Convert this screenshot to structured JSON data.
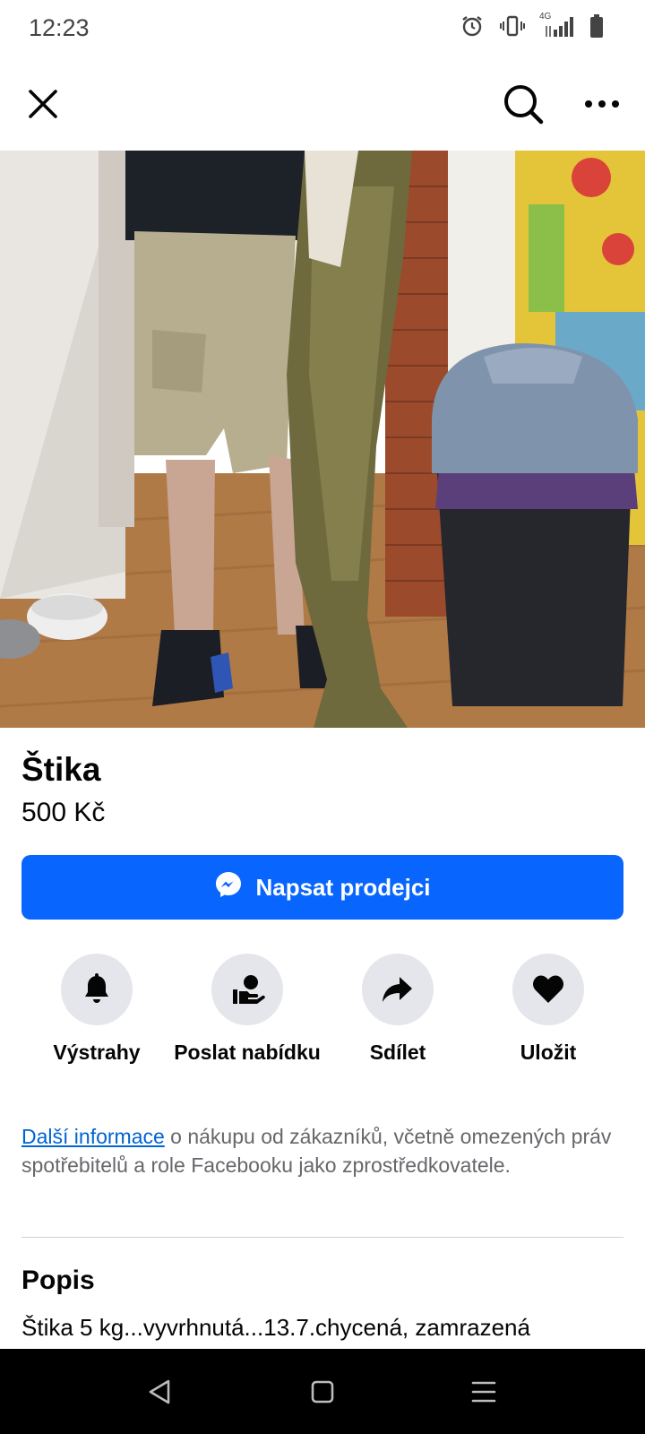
{
  "status_bar": {
    "time": "12:23",
    "network": "4G",
    "icons": [
      "alarm-icon",
      "vibrate-icon",
      "signal-icon",
      "battery-icon"
    ]
  },
  "top_bar": {
    "icons": [
      "close-icon",
      "search-icon",
      "more-icon"
    ]
  },
  "listing": {
    "title": "Štika",
    "price": "500 Kč",
    "message_button": "Napsat prodejci"
  },
  "actions": [
    {
      "label": "Výstrahy",
      "icon": "bell-icon"
    },
    {
      "label": "Poslat nabídku",
      "icon": "offer-icon"
    },
    {
      "label": "Sdílet",
      "icon": "share-icon"
    },
    {
      "label": "Uložit",
      "icon": "heart-icon"
    }
  ],
  "info": {
    "link": "Další informace",
    "text": " o nákupu od zákazníků, včetně omezených práv spotřebitelů a role Facebooku jako zprostředkovatele."
  },
  "description": {
    "heading": "Popis",
    "text": "Štika 5 kg...vyvrhnutá...13.7.chycená, zamrazená"
  },
  "nav_bar": {
    "icons": [
      "back-icon",
      "home-icon",
      "menu-icon"
    ]
  },
  "colors": {
    "accent": "#0866ff",
    "link": "#0064d1",
    "action_bg": "#e4e6eb"
  }
}
